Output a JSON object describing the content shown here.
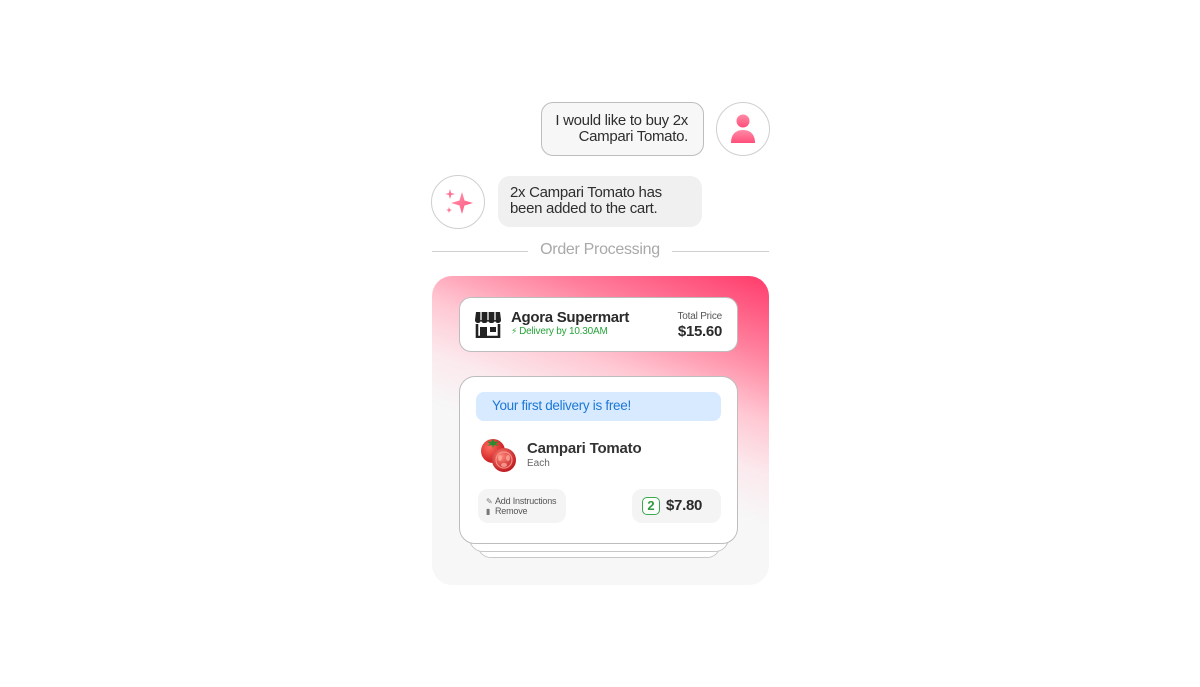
{
  "chat": {
    "user_message": "I would like to buy 2x Campari Tomato.",
    "assistant_message": "2x Campari Tomato has been added to the cart.",
    "user_avatar_icon": "person-icon",
    "assistant_avatar_icon": "sparkles-icon"
  },
  "divider": {
    "label": "Order Processing"
  },
  "store": {
    "name": "Agora Supermart",
    "delivery_icon": "bolt-icon",
    "delivery": "Delivery by 10.30AM",
    "total_label": "Total Price",
    "total_value": "$15.60",
    "icon": "storefront-icon"
  },
  "item_card": {
    "promo": "Your first delivery is free!",
    "product": {
      "name": "Campari Tomato",
      "unit": "Each",
      "image_icon": "tomato-icon"
    },
    "actions": {
      "add_instructions": "Add Instructions",
      "remove": "Remove"
    },
    "quantity": "2",
    "price": "$7.80"
  },
  "colors": {
    "accent_pink": "#ff3b6b",
    "delivery_green": "#27a33a",
    "promo_blue": "#1b78d6",
    "promo_bg": "#d8eaff"
  }
}
